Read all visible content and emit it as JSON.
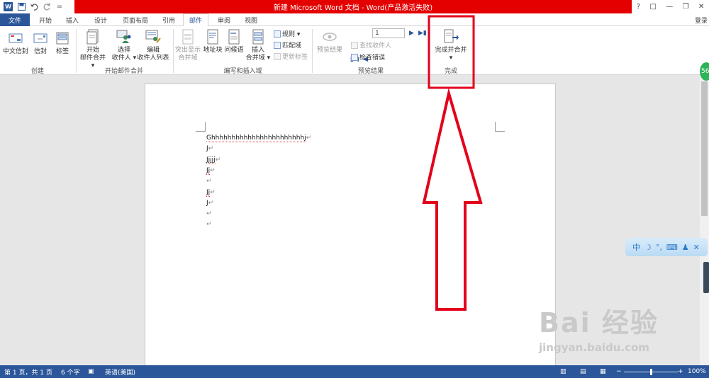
{
  "title_bar": {
    "title": "新建 Microsoft Word 文档 - Word(产品激活失败)",
    "help": "?",
    "restore": "□",
    "minimize": "—",
    "maximize": "❐",
    "close": "✕"
  },
  "quick_access": {
    "app_icon": "word-logo-icon",
    "logo_letter": "W",
    "save_icon": "save-icon",
    "undo_icon": "undo-icon",
    "redo_icon": "redo-icon",
    "customize": "="
  },
  "tabs": [
    {
      "label": "文件"
    },
    {
      "label": "开始"
    },
    {
      "label": "插入"
    },
    {
      "label": "设计"
    },
    {
      "label": "页面布局"
    },
    {
      "label": "引用"
    },
    {
      "label": "邮件"
    },
    {
      "label": "审阅"
    },
    {
      "label": "视图"
    }
  ],
  "login_label": "登录",
  "ribbon": {
    "groups": {
      "create": {
        "label": "创建",
        "buttons": [
          "中文信封",
          "信封",
          "标签"
        ]
      },
      "start_merge": {
        "label": "开始邮件合并",
        "buttons": [
          {
            "line1": "开始",
            "line2": "邮件合并 ▾"
          },
          {
            "line1": "选择",
            "line2": "收件人 ▾"
          },
          {
            "line1": "编辑",
            "line2": "收件人列表"
          }
        ]
      },
      "write_insert": {
        "label": "编写和插入域",
        "buttons": [
          {
            "line1": "突出显示",
            "line2": "合并域"
          },
          {
            "line1": "地址块",
            "line2": ""
          },
          {
            "line1": "问候语",
            "line2": ""
          },
          {
            "line1": "插入",
            "line2": "合并域 ▾"
          }
        ],
        "small": [
          "规则 ▾",
          "匹配域",
          "更新标签"
        ]
      },
      "preview": {
        "label": "预览结果",
        "preview_button": "预览结果",
        "record_value": "1",
        "small": [
          "查找收件人",
          "检查错误"
        ]
      },
      "finish": {
        "label": "完成",
        "button": "完成并合并",
        "dropdown": "▾"
      }
    }
  },
  "document": {
    "lines": [
      {
        "text": "Ghhhhhhhhhhhhhhhhhhhhhhhj",
        "mark": "↵",
        "squiggle": true
      },
      {
        "text": "J",
        "mark": "↵",
        "squiggle": false
      },
      {
        "text": "Jjjjj",
        "mark": "↵",
        "squiggle": true
      },
      {
        "text": "Jj",
        "mark": "↵",
        "squiggle": true
      },
      {
        "text": "",
        "mark": "↵",
        "squiggle": false
      },
      {
        "text": "Jj",
        "mark": "↵",
        "squiggle": true
      },
      {
        "text": "J",
        "mark": "↵",
        "squiggle": false
      },
      {
        "text": "",
        "mark": "↵",
        "squiggle": false
      },
      {
        "text": "",
        "mark": "↵",
        "squiggle": false
      }
    ]
  },
  "status_bar": {
    "page": "第 1 页，共 1 页",
    "words": "6 个字",
    "language": "英语(美国)",
    "zoom": "100%",
    "zoom_minus": "−",
    "zoom_plus": "+",
    "zoom_level": 0.5
  },
  "overlay": {
    "ime_text": "中",
    "badge": "56",
    "watermark": "Bai  经验",
    "watermark_url": "jingyan.baidu.com"
  },
  "colors": {
    "accent": "#2b579a",
    "title_red": "#e50000",
    "annotation_red": "#e3001b"
  }
}
